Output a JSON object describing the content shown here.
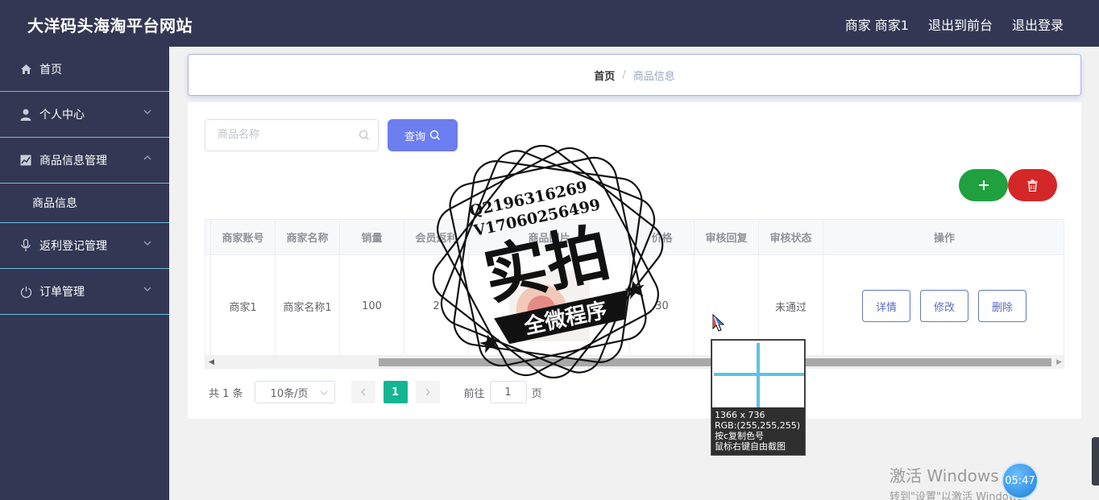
{
  "header": {
    "title": "大洋码头海淘平台网站",
    "user_label": "商家 商家1",
    "front_label": "退出到前台",
    "logout_label": "退出登录"
  },
  "sidebar": {
    "items": [
      {
        "label": "首页",
        "icon": "home-icon"
      },
      {
        "label": "个人中心",
        "icon": "user-icon"
      },
      {
        "label": "商品信息管理",
        "icon": "chart-icon"
      },
      {
        "label": "商品信息"
      },
      {
        "label": "返利登记管理",
        "icon": "microphone-icon"
      },
      {
        "label": "订单管理",
        "icon": "power-icon"
      }
    ]
  },
  "breadcrumb": {
    "home": "首页",
    "separator": "/",
    "current": "商品信息"
  },
  "search": {
    "placeholder": "商品名称",
    "button_label": "查询"
  },
  "table": {
    "headers": [
      "商家账号",
      "商家名称",
      "销量",
      "会员返利",
      "商品图片",
      "价格",
      "审核回复",
      "审核状态",
      "操作"
    ],
    "rows": [
      {
        "account": "商家1",
        "name": "商家名称1",
        "sales": "100",
        "rebate": "2",
        "price": "30",
        "reply": "",
        "status": "未通过"
      }
    ],
    "actions": {
      "detail": "详情",
      "edit": "修改",
      "delete": "删除"
    }
  },
  "pagination": {
    "total": "共 1 条",
    "page_size": "10条/页",
    "current_page": "1",
    "goto_prefix": "前往",
    "goto_value": "1",
    "goto_suffix": "页"
  },
  "picker": {
    "size": "1366 x 736",
    "rgb": "RGB:(255,255,255)",
    "hint1": "按c复制色号",
    "hint2": "鼠标右键自由截图"
  },
  "watermark": {
    "qq": "Q2196316269",
    "vx": "V17060256499",
    "big": "实拍",
    "banner": "全微程序"
  },
  "windows": {
    "line1": "激活 Windows",
    "line2": "转到\"设置\"以激活 Windows。",
    "clock": "05:47"
  },
  "colors": {
    "header_bg": "#333753",
    "accent": "#6c7ef0",
    "success": "#20a03f",
    "danger": "#d42727",
    "page_active": "#13b593"
  }
}
